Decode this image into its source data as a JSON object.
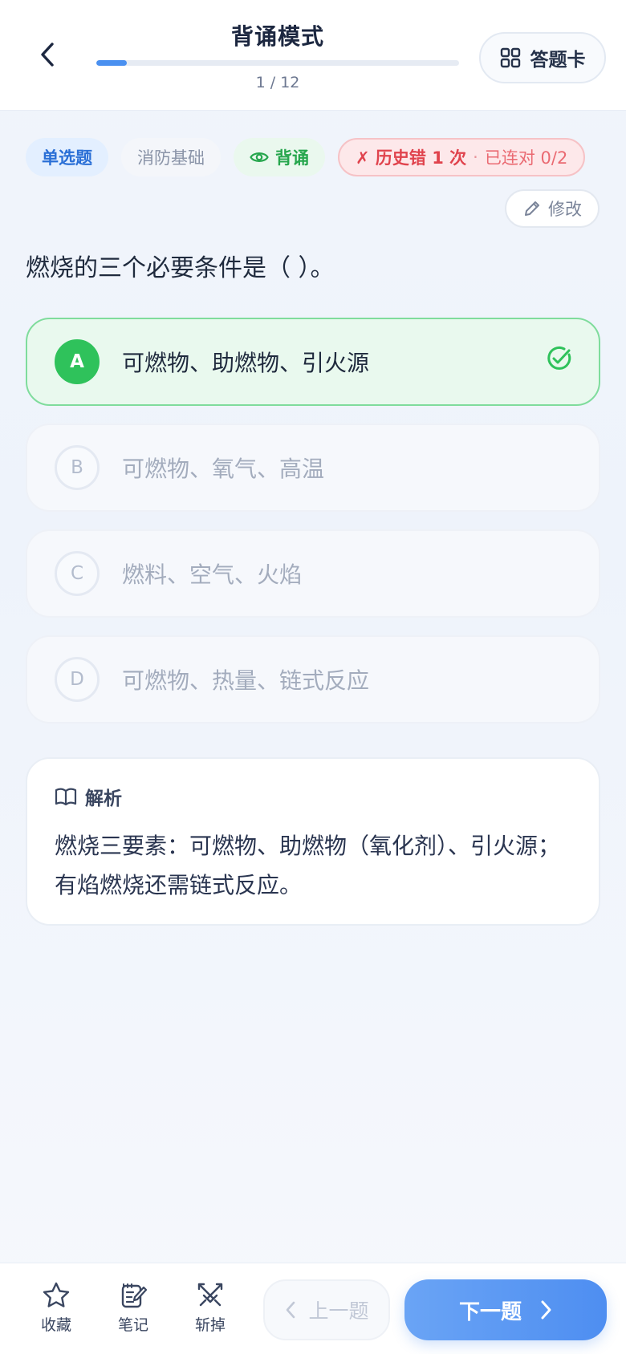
{
  "header": {
    "title": "背诵模式",
    "progress_text": "1 / 12",
    "progress_fraction": 0.083,
    "card_button_label": "答题卡"
  },
  "tags": {
    "type": "单选题",
    "category": "消防基础",
    "mode": "背诵",
    "history_wrong": "✗ 历史错 1 次",
    "history_sep": "·",
    "history_streak": "已连对 0/2"
  },
  "edit_label": "修改",
  "question": "燃烧的三个必要条件是（ ）。",
  "options": [
    {
      "letter": "A",
      "text": "可燃物、助燃物、引火源",
      "correct": true
    },
    {
      "letter": "B",
      "text": "可燃物、氧气、高温",
      "correct": false
    },
    {
      "letter": "C",
      "text": "燃料、空气、火焰",
      "correct": false
    },
    {
      "letter": "D",
      "text": "可燃物、热量、链式反应",
      "correct": false
    }
  ],
  "analysis": {
    "title": "解析",
    "body": "燃烧三要素：可燃物、助燃物（氧化剂）、引火源；有焰燃烧还需链式反应。"
  },
  "bottom": {
    "favorite_label": "收藏",
    "note_label": "笔记",
    "remove_label": "斩掉",
    "prev_label": "上一题",
    "next_label": "下一题"
  },
  "colors": {
    "accent": "#4e8ef1",
    "correct": "#2fc25b",
    "danger": "#e0434d"
  },
  "icons": {
    "back": "chevron-left-icon",
    "card": "grid-icon",
    "mode": "eye-icon",
    "edit": "pencil-icon",
    "check": "check-circle-icon",
    "analysis": "book-icon",
    "favorite": "star-icon",
    "note": "note-edit-icon",
    "remove": "crossed-swords-icon",
    "prev": "chevron-left-icon",
    "next": "chevron-right-icon"
  }
}
